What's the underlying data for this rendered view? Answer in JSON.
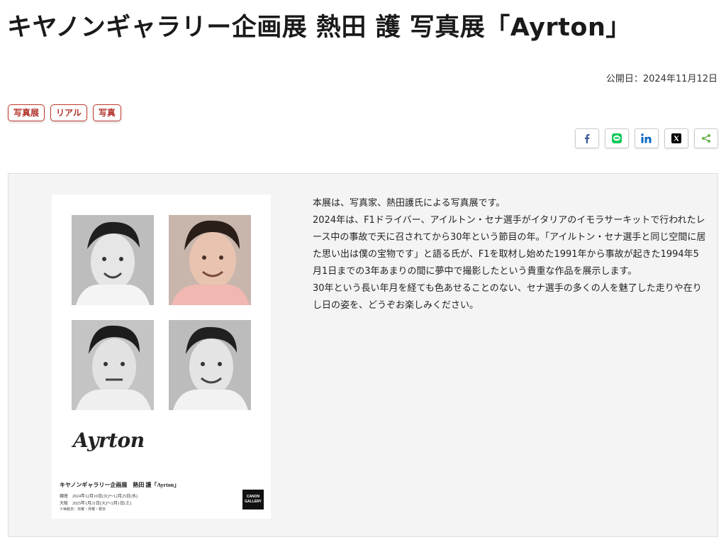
{
  "page": {
    "title": "キヤノンギャラリー企画展 熱田 護 写真展「Ayrton」",
    "publish_date": "公開日：2024年11月12日"
  },
  "tags": [
    "写真展",
    "リアル",
    "写真"
  ],
  "share": [
    {
      "icon": "facebook-icon",
      "glyph": "f",
      "color": "#3b5998"
    },
    {
      "icon": "line-icon",
      "glyph": "LINE",
      "color": "#06c755"
    },
    {
      "icon": "linkedin-icon",
      "glyph": "in",
      "color": "#0a66c2"
    },
    {
      "icon": "x-icon",
      "glyph": "𝕏",
      "color": "#000000"
    },
    {
      "icon": "share-icon",
      "glyph": "share",
      "color": "#6ab04c"
    }
  ],
  "poster": {
    "logo": "Ayrton",
    "title": "キヤノンギャラリー企画展　熱田 護「Ayrton」",
    "line1": "銀座　2024年12月10日(火)～12月25日(水)",
    "line2": "大阪　2025年1月21日(火)～2月1日(土)",
    "line3": "※休館日：日曜・月曜・祝日",
    "badge_line1": "CANON",
    "badge_line2": "GALLERY"
  },
  "description": [
    "本展は、写真家、熱田護氏による写真展です。",
    "2024年は、F1ドライバー、アイルトン・セナ選手がイタリアのイモラサーキットで行われたレース中の事故で天に召されてから30年という節目の年。「アイルトン・セナ選手と同じ空間に居た思い出は僕の宝物です」と語る氏が、F1を取材し始めた1991年から事故が起きた1994年5月1日までの3年あまりの間に夢中で撮影したという貴重な作品を展示します。",
    "30年という長い年月を経ても色あせることのない、セナ選手の多くの人を魅了した走りや在りし日の姿を、どうぞお楽しみください。"
  ]
}
